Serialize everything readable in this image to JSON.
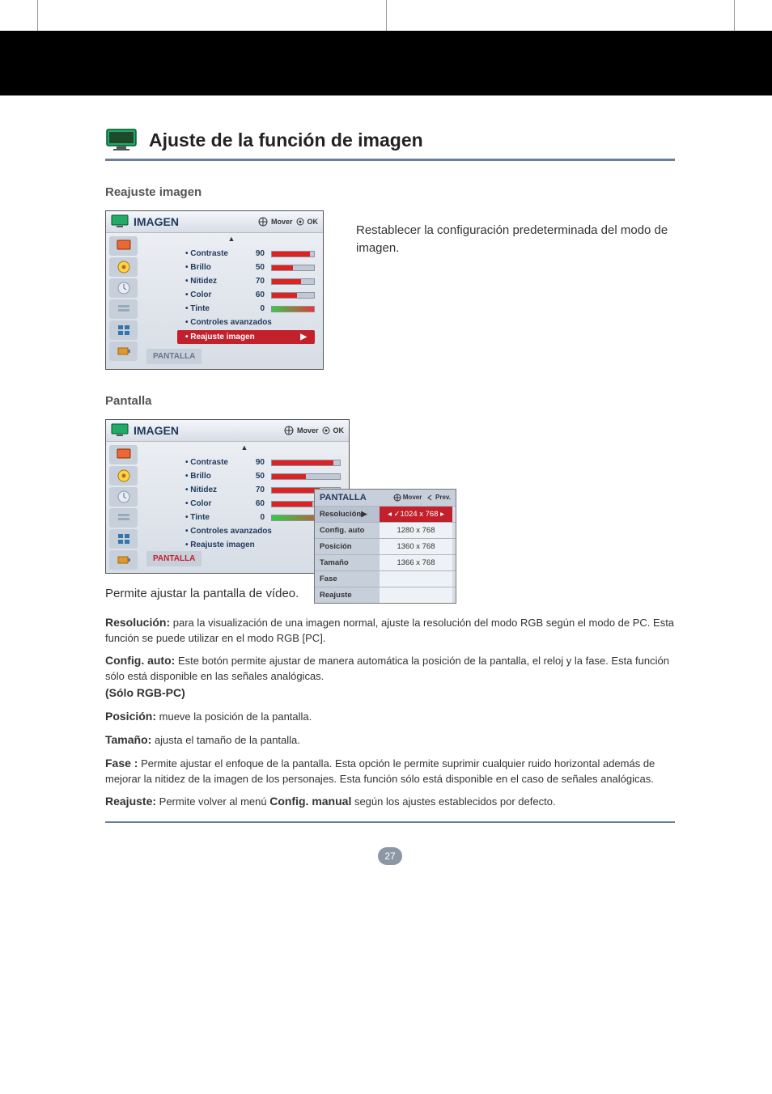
{
  "page": {
    "title": "Ajuste de la función de imagen",
    "number": "27"
  },
  "reajuste": {
    "heading": "Reajuste imagen",
    "description": "Restablecer la configuración predeterminada del modo de imagen."
  },
  "osd": {
    "title": "IMAGEN",
    "hint_move": "Mover",
    "hint_ok": "OK",
    "items": {
      "contraste": {
        "label": "• Contraste",
        "value": "90",
        "fill": 90
      },
      "brillo": {
        "label": "• Brillo",
        "value": "50",
        "fill": 50
      },
      "nitidez": {
        "label": "• Nitidez",
        "value": "70",
        "fill": 70
      },
      "color": {
        "label": "• Color",
        "value": "60",
        "fill": 60
      },
      "tinte": {
        "label": "• Tinte",
        "value": "0"
      }
    },
    "controles": "• Controles avanzados",
    "reajuste": "• Reajuste imagen",
    "pantalla_tab": "PANTALLA"
  },
  "pantalla": {
    "heading": "Pantalla",
    "submenu": {
      "title": "PANTALLA",
      "hint_move": "Mover",
      "hint_prev": "Prev.",
      "rows": {
        "resolucion": {
          "label": "Resolución▶",
          "value": "1024 x 768"
        },
        "config_auto": {
          "label": "Config. auto",
          "value": "1280 x 768"
        },
        "posicion": {
          "label": "Posición",
          "value": "1360 x 768"
        },
        "tamano": {
          "label": "Tamaño",
          "value": "1366 x 768"
        },
        "fase": {
          "label": "Fase"
        },
        "reajuste": {
          "label": "Reajuste"
        }
      }
    },
    "intro": "Permite ajustar la pantalla de vídeo.",
    "defs": {
      "resolucion": {
        "term": "Resolución:",
        "text": "para la visualización de una imagen normal, ajuste la resolución del modo RGB según el modo de PC. Esta función se puede utilizar en el modo RGB [PC]."
      },
      "config_auto": {
        "term": "Config. auto:",
        "note": "(Sólo RGB-PC)",
        "text": "Este botón permite ajustar de manera automática la posición de la pantalla, el reloj y la fase. Esta función sólo está disponible en las señales analógicas."
      },
      "posicion": {
        "term": "Posición:",
        "text": "mueve la posición de la pantalla."
      },
      "tamano": {
        "term": "Tamaño:",
        "text": "ajusta el tamaño de la pantalla."
      },
      "fase": {
        "term": "Fase :",
        "text": "Permite ajustar el enfoque de la pantalla. Esta opción le permite suprimir cualquier ruido horizontal además de mejorar la nitidez de la imagen de los personajes. Esta función sólo está disponible en el caso de señales analógicas."
      },
      "reajuste": {
        "term": "Reajuste:",
        "text1": "Permite volver al menú ",
        "bold": "Config. manual",
        "text2": " según los ajustes establecidos por defecto."
      }
    }
  }
}
